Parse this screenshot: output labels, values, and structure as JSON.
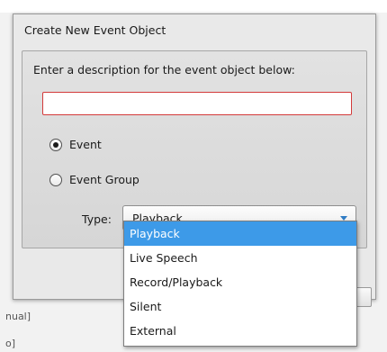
{
  "background": {
    "snippet_1": "nual]",
    "snippet_2": "o]"
  },
  "dialog": {
    "title": "Create New Event Object",
    "prompt": "Enter a description for the event object below:",
    "description_value": "",
    "radio_event_label": "Event",
    "radio_group_label": "Event Group",
    "selected_radio": "Event",
    "type_label": "Type:",
    "type_selected": "Playback",
    "type_options": [
      "Playback",
      "Live Speech",
      "Record/Playback",
      "Silent",
      "External"
    ]
  },
  "colors": {
    "input_error_border": "#d33a3a",
    "selection": "#3d9ae8",
    "caret": "#2f7cc4",
    "ok_button": "#48a048"
  }
}
